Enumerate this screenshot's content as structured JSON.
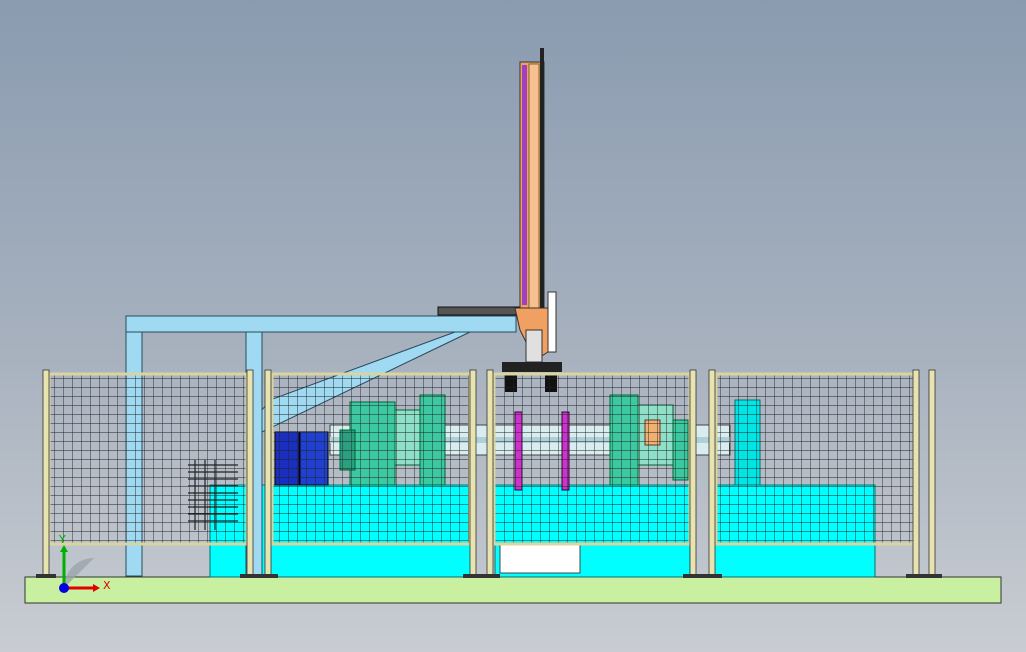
{
  "triad": {
    "x_label": "X",
    "y_label": "Y"
  },
  "colors": {
    "background_top": "#8a9bb0",
    "background_bottom": "#c9cdd2",
    "floor_plate": "#c8f0a0",
    "fence_frame": "#e8e4b0",
    "mesh": "#1a1a1a",
    "gantry": "#9fd9f2",
    "cyan_bed": "#00ffff",
    "teal_fixture": "#3cc8a0",
    "blue_block": "#1a2fbf",
    "magenta_rod": "#cc33cc",
    "orange_slide": "#f0a060",
    "axis_x": "#e00000",
    "axis_y": "#00b000",
    "axis_z": "#0000e0"
  }
}
